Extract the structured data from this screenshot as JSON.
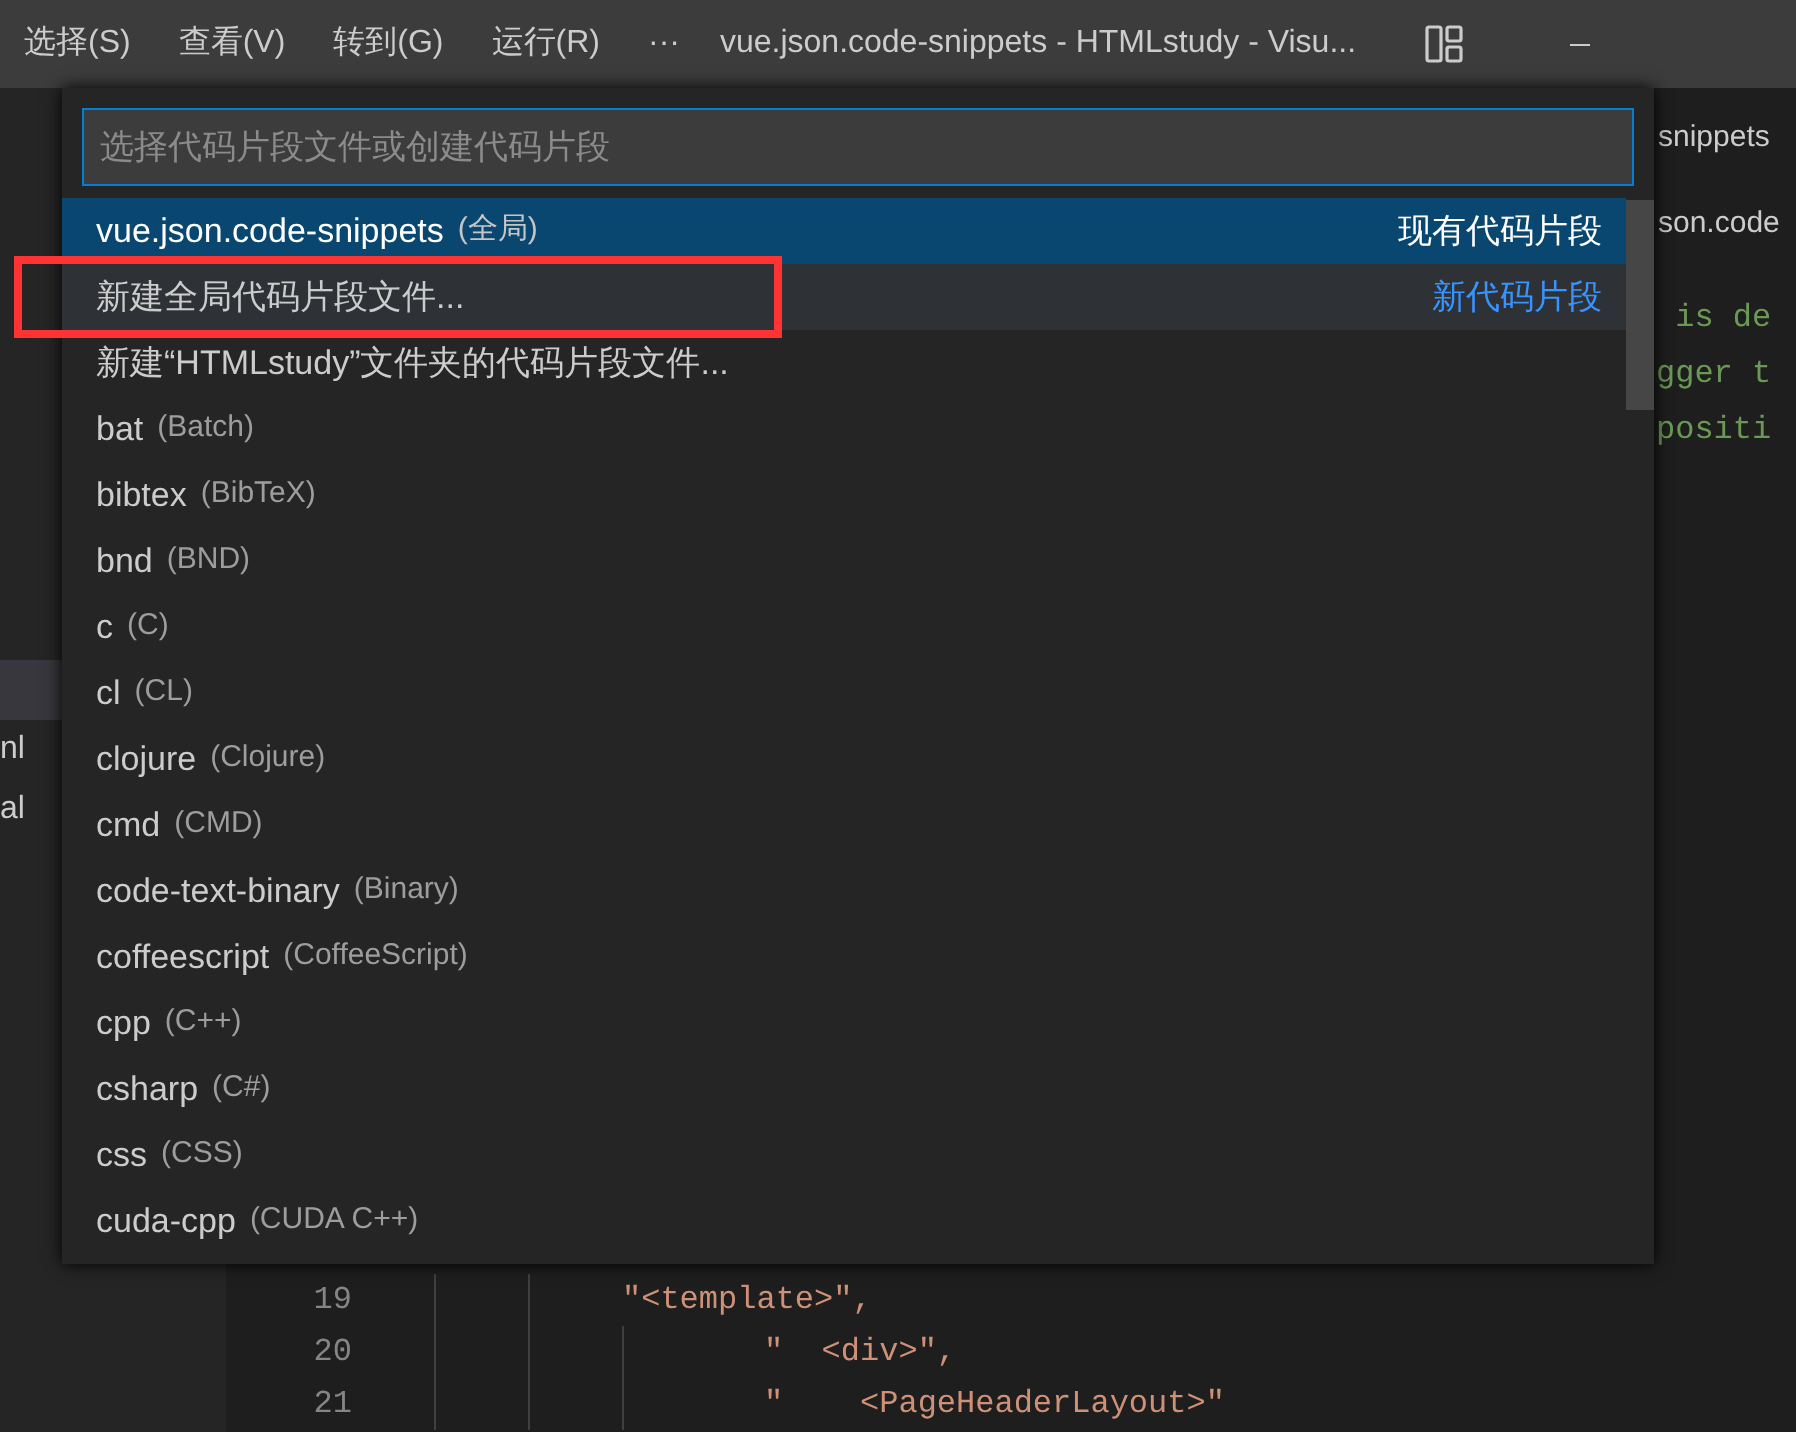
{
  "title_bar": {
    "menus": [
      "选择(S)",
      "查看(V)",
      "转到(G)",
      "运行(R)"
    ],
    "overflow": "···",
    "title": "vue.json.code-snippets - HTMLstudy - Visu..."
  },
  "sidebar": {
    "items": [
      {
        "selected": true
      },
      {
        "label": "nl",
        "selected": false
      },
      {
        "label": "al",
        "selected": false
      }
    ]
  },
  "editor": {
    "tab": "snippets",
    "breadcrumb": "son.code",
    "comment_lines": [
      " is de",
      "gger t",
      "positi"
    ],
    "code_lines": [
      {
        "number": "19",
        "text": "\"<template>\",",
        "kind": "outer"
      },
      {
        "number": "20",
        "text": "\"  <div>\",",
        "kind": "inner"
      },
      {
        "number": "21",
        "text": "\"    <PageHeaderLayout>\"",
        "kind": "inner"
      }
    ]
  },
  "quick_pick": {
    "placeholder": "选择代码片段文件或创建代码片段",
    "items": [
      {
        "label": "vue.json.code-snippets",
        "description": "(全局)",
        "tag": "现有代码片段",
        "kind": "existing",
        "selected": true,
        "hovered": false,
        "annotated": false
      },
      {
        "label": "新建全局代码片段文件...",
        "tag": "新代码片段",
        "kind": "new",
        "selected": false,
        "hovered": true,
        "annotated": true
      },
      {
        "label": "新建“HTMLstudy”文件夹的代码片段文件...",
        "selected": false,
        "hovered": false,
        "annotated": false
      },
      {
        "label": "bat",
        "description": "(Batch)",
        "selected": false,
        "hovered": false,
        "annotated": false
      },
      {
        "label": "bibtex",
        "description": "(BibTeX)",
        "selected": false,
        "hovered": false,
        "annotated": false
      },
      {
        "label": "bnd",
        "description": "(BND)",
        "selected": false,
        "hovered": false,
        "annotated": false
      },
      {
        "label": "c",
        "description": "(C)",
        "selected": false,
        "hovered": false,
        "annotated": false
      },
      {
        "label": "cl",
        "description": "(CL)",
        "selected": false,
        "hovered": false,
        "annotated": false
      },
      {
        "label": "clojure",
        "description": "(Clojure)",
        "selected": false,
        "hovered": false,
        "annotated": false
      },
      {
        "label": "cmd",
        "description": "(CMD)",
        "selected": false,
        "hovered": false,
        "annotated": false
      },
      {
        "label": "code-text-binary",
        "description": "(Binary)",
        "selected": false,
        "hovered": false,
        "annotated": false
      },
      {
        "label": "coffeescript",
        "description": "(CoffeeScript)",
        "selected": false,
        "hovered": false,
        "annotated": false
      },
      {
        "label": "cpp",
        "description": "(C++)",
        "selected": false,
        "hovered": false,
        "annotated": false
      },
      {
        "label": "csharp",
        "description": "(C#)",
        "selected": false,
        "hovered": false,
        "annotated": false
      },
      {
        "label": "css",
        "description": "(CSS)",
        "selected": false,
        "hovered": false,
        "annotated": false
      },
      {
        "label": "cuda-cpp",
        "description": "(CUDA C++)",
        "selected": false,
        "hovered": false,
        "annotated": false
      }
    ]
  }
}
